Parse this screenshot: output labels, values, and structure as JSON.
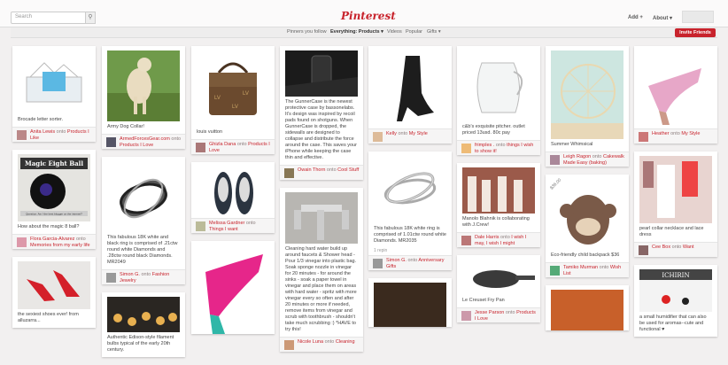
{
  "header": {
    "search_placeholder": "Search",
    "logo": "Pinterest",
    "add": "Add +",
    "about": "About ▾"
  },
  "subnav": {
    "pinners": "Pinners you follow",
    "everything": "Everything: Products ▾",
    "videos": "Videos",
    "popular": "Popular",
    "gifts": "Gifts ▾",
    "invite": "Invite Friends"
  },
  "colors": {
    "accent": "#c8232c",
    "background": "#f2f0f0"
  },
  "pins": [
    {
      "desc": "Brocade letter sorter.",
      "user": "Anita Lewis",
      "onto": "onto",
      "board": "Products I Like"
    },
    {
      "desc": "Army Dog Collar!",
      "user": "ArmedForcesGear.com",
      "onto": "onto",
      "board": "Products I Love"
    },
    {
      "desc": "louis vuitton",
      "user": "Ghizla Dana",
      "onto": "onto",
      "board": "Products I Love"
    },
    {
      "desc": "The GunnerCase is the newest protective case by bassonelabs. It's design was inspired by recoil pads found on shotguns. When GunnerCase is dropped, the sidewalls are designed to collapse and distribute the force around the case. This saves your iPhone while keeping the case thin and effective.",
      "user": "Owain Thorn",
      "onto": "onto",
      "board": "Cool Stuff"
    },
    {
      "desc": "",
      "user": "Kelly",
      "onto": "onto",
      "board": "My Style"
    },
    {
      "desc": "c&b's exquisite pitcher. outlet priced 13usd. 80c pay",
      "user": "frimples .",
      "onto": "onto",
      "board": "things I wish to show it!"
    },
    {
      "desc": "Summer Whimsical",
      "user": "Leigh Ragon",
      "onto": "onto",
      "board": "Cakewalk Made Easy (baking)"
    },
    {
      "desc": "",
      "user": "Heather",
      "onto": "onto",
      "board": "My Style"
    },
    {
      "title": "Magic Eight Ball",
      "caption": "Question: Am I the best blogger on the internet?",
      "desc": "How about the magic 8 ball?",
      "user": "Flora Garcia-Alvarez",
      "onto": "onto",
      "board": "Memories from my early life"
    },
    {
      "desc": "This fabulous 18K white and black ring is comprised of .21ctw round white Diamonds and .28ctw round black Diamonds. MR2049",
      "user": "Simon G.",
      "onto": "onto",
      "board": "Fashion Jewelry"
    },
    {
      "desc": "",
      "user": "Melissa Gardner",
      "onto": "onto",
      "board": "Things I want"
    },
    {
      "desc": "Cleaning hard water build up around faucets & Shower head - Pour 1/3 vinegar into plastic bag. Soak sponge nozzle in vinegar for 20 minutes - for around the sinks - soak a paper towel in vinegar and place them on areas with hard water - spritz with more vinegar every so often and after 20 minutes or more if needed, remove items from vinegar and scrub with toothbrush - shouldn't take much scrubbing :) *HAVE to try this!",
      "user": "Nicole Luna",
      "onto": "onto",
      "board": "Cleaning"
    },
    {
      "desc": "This fabulous 18K white ring is comprised of 1.01ctw round white Diamonds. MR2035",
      "repin": "1 repin",
      "user": "Simon G.",
      "onto": "onto",
      "board": "Anniversary Gifts"
    },
    {
      "desc": "Manolo Blahnik is collaborating with J.Crew!",
      "user": "Dale Harris",
      "onto": "onto",
      "board": "I wish I may, I wish I might"
    },
    {
      "price": "$36.00",
      "desc": "Eco-friendly child backpack $36",
      "user": "Tamiko Murman",
      "onto": "onto",
      "board": "Wish List"
    },
    {
      "desc": "pearl collar necklace and lace dress",
      "user": "Cee Box",
      "onto": "onto",
      "board": "Want"
    },
    {
      "desc": "the sexiest shoes ever! from alluzarra..."
    },
    {
      "desc": "Authentic Edison-style filament bulbs typical of the early 20th century."
    },
    {
      "desc": ""
    },
    {
      "desc": ""
    },
    {
      "desc": "Le Creuset Fry Pan",
      "user": "Jesse Parson",
      "onto": "onto",
      "board": "Products I Love"
    },
    {
      "desc": ""
    },
    {
      "title": "ICHIRIN",
      "desc": "a small humidifier that can also be used for aromas--cute and functional ♥"
    }
  ]
}
